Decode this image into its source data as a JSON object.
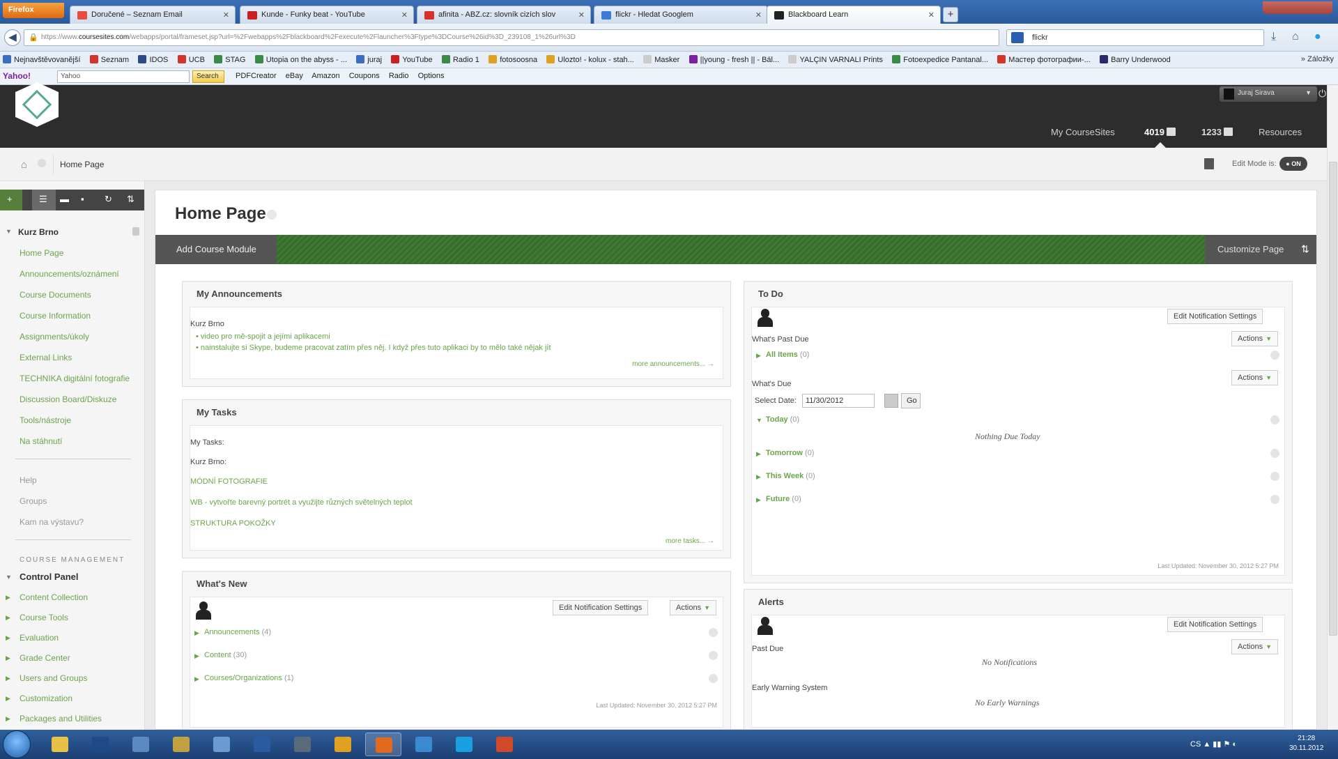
{
  "browser": {
    "menu_label": "Firefox",
    "tabs": [
      {
        "label": "Doručené – Seznam Email",
        "color": "#e84c3d"
      },
      {
        "label": "Kunde - Funky beat - YouTube",
        "color": "#cc1f1f"
      },
      {
        "label": "afinita - ABZ.cz: slovník cizích slov",
        "color": "#d9302c"
      },
      {
        "label": "flickr - Hledat Googlem",
        "color": "#3b7bd8"
      },
      {
        "label": "Blackboard Learn",
        "color": "#222222"
      }
    ],
    "url_prefix": "https://www.",
    "url_domain": "coursesites.com",
    "url_rest": "/webapps/portal/frameset.jsp?url=%2Fwebapps%2Fblackboard%2Fexecute%2Flauncher%3Ftype%3DCourse%26id%3D_239108_1%26url%3D",
    "search_value": "flickr",
    "bookmarks": [
      {
        "label": "Nejnavštěvovanější",
        "color": "#3a6fc0"
      },
      {
        "label": "Seznam",
        "color": "#d6332a"
      },
      {
        "label": "IDOS",
        "color": "#2a4a8a"
      },
      {
        "label": "UCB",
        "color": "#d6332a"
      },
      {
        "label": "STAG",
        "color": "#3a8a4a"
      },
      {
        "label": "Utopia on the abyss - ...",
        "color": "#3a8a4a"
      },
      {
        "label": "juraj",
        "color": "#3a6fc0"
      },
      {
        "label": "YouTube",
        "color": "#cc1f1f"
      },
      {
        "label": "Radio 1",
        "color": "#3a8a4a"
      },
      {
        "label": "fotosoosna",
        "color": "#e0a020"
      },
      {
        "label": "Ulozto! - kolux - stah...",
        "color": "#e0a020"
      },
      {
        "label": "Masker",
        "color": "#cccccc"
      },
      {
        "label": "||young - fresh || - Bál...",
        "color": "#7a1fa2"
      },
      {
        "label": "YALÇIN VARNALI Prints",
        "color": "#cccccc"
      },
      {
        "label": "Fotoexpedice Pantanal...",
        "color": "#3a8a4a"
      },
      {
        "label": "Мастер фотографии-...",
        "color": "#d6332a"
      },
      {
        "label": "Barry Underwood",
        "color": "#2a2a6a"
      }
    ],
    "bookmarks_right": "Záložky",
    "yahoo_logo": "Yahoo!",
    "yahoo_input": "Yahoo",
    "yahoo_search": "Search",
    "toolbar2_items": [
      "PDFCreator",
      "eBay",
      "Amazon",
      "Coupons",
      "Radio",
      "Options"
    ]
  },
  "bb": {
    "user_name": "Juraj Sirava",
    "nav": {
      "my_coursesites": "My CourseSites",
      "course1": "4019",
      "course2": "1233",
      "resources": "Resources"
    },
    "breadcrumb": "Home Page",
    "edit_mode_label": "Edit Mode is:",
    "edit_mode_value": "ON"
  },
  "sidebar": {
    "course_name": "Kurz Brno",
    "items": [
      {
        "label": "Home Page"
      },
      {
        "label": "Announcements/oznámení"
      },
      {
        "label": "Course Documents"
      },
      {
        "label": "Course Information"
      },
      {
        "label": "Assignments/úkoly"
      },
      {
        "label": "External Links"
      },
      {
        "label": "TECHNIKA digitální fotografie"
      },
      {
        "label": "Discussion Board/Diskuze"
      },
      {
        "label": "Tools/nástroje"
      },
      {
        "label": "Na stáhnutí"
      }
    ],
    "items2": [
      {
        "label": "Help"
      },
      {
        "label": "Groups"
      },
      {
        "label": "Kam na výstavu?"
      }
    ],
    "management_heading": "COURSE MANAGEMENT",
    "control_panel": "Control Panel",
    "cp_items": [
      {
        "label": "Content Collection"
      },
      {
        "label": "Course Tools"
      },
      {
        "label": "Evaluation"
      },
      {
        "label": "Grade Center"
      },
      {
        "label": "Users and Groups"
      },
      {
        "label": "Customization"
      },
      {
        "label": "Packages and Utilities"
      }
    ]
  },
  "main": {
    "title": "Home Page",
    "add_course_module": "Add Course Module",
    "customize_page": "Customize Page",
    "announcements": {
      "title": "My Announcements",
      "course": "Kurz Brno",
      "items": [
        "video pro mě-spojit a jejími aplikacemi",
        "nainstalujte si Skype, budeme pracovat zatím přes něj. I když přes tuto aplikaci by to mělo také nějak jít"
      ],
      "more": "more announcements... →"
    },
    "tasks": {
      "title": "My Tasks",
      "label": "My Tasks:",
      "course": "Kurz Brno:",
      "items": [
        "MÓDNÍ FOTOGRAFIE",
        "WB - vytvořte barevný portrét a využijte různých světelných teplot",
        "STRUKTURA POKOŽKY"
      ],
      "more": "more tasks... →"
    },
    "whats_new": {
      "title": "What's New",
      "edit_notifications": "Edit Notification Settings",
      "actions": "Actions",
      "items": [
        {
          "label": "Announcements",
          "count": "(4)"
        },
        {
          "label": "Content",
          "count": "(30)"
        },
        {
          "label": "Courses/Organizations",
          "count": "(1)"
        }
      ],
      "last_updated": "Last Updated: November 30, 2012 5:27 PM"
    },
    "todo": {
      "title": "To Do",
      "edit_notifications": "Edit Notification Settings",
      "past_due_label": "What's Past Due",
      "actions": "Actions",
      "all_items": "All Items",
      "all_items_count": "(0)",
      "due_label": "What's Due",
      "select_date_label": "Select Date:",
      "select_date_value": "11/30/2012",
      "go": "Go",
      "today": "Today",
      "today_count": "(0)",
      "nothing_due": "Nothing Due Today",
      "tomorrow": "Tomorrow",
      "tomorrow_count": "(0)",
      "this_week": "This Week",
      "this_week_count": "(0)",
      "future": "Future",
      "future_count": "(0)",
      "last_updated": "Last Updated: November 30, 2012 5:27 PM"
    },
    "alerts": {
      "title": "Alerts",
      "edit_notifications": "Edit Notification Settings",
      "actions": "Actions",
      "past_due": "Past Due",
      "no_notifications": "No Notifications",
      "early_warning": "Early Warning System",
      "no_warnings": "No Early Warnings"
    }
  },
  "taskbar": {
    "tray_lang": "CS",
    "time": "21:28",
    "date": "30.11.2012",
    "apps": [
      {
        "name": "explorer",
        "color": "#e8c048"
      },
      {
        "name": "photoshop",
        "color": "#1f4a8a"
      },
      {
        "name": "network",
        "color": "#5a8ac0"
      },
      {
        "name": "winamp",
        "color": "#c0a040"
      },
      {
        "name": "remote",
        "color": "#6a9ad0"
      },
      {
        "name": "save",
        "color": "#2a5aa0"
      },
      {
        "name": "calculator",
        "color": "#5a6a7a"
      },
      {
        "name": "chrome",
        "color": "#e0a020"
      },
      {
        "name": "firefox",
        "color": "#e06a20"
      },
      {
        "name": "ie",
        "color": "#3a8ad0"
      },
      {
        "name": "skype",
        "color": "#1aa0e0"
      },
      {
        "name": "powerpoint",
        "color": "#d04a2a"
      }
    ]
  }
}
